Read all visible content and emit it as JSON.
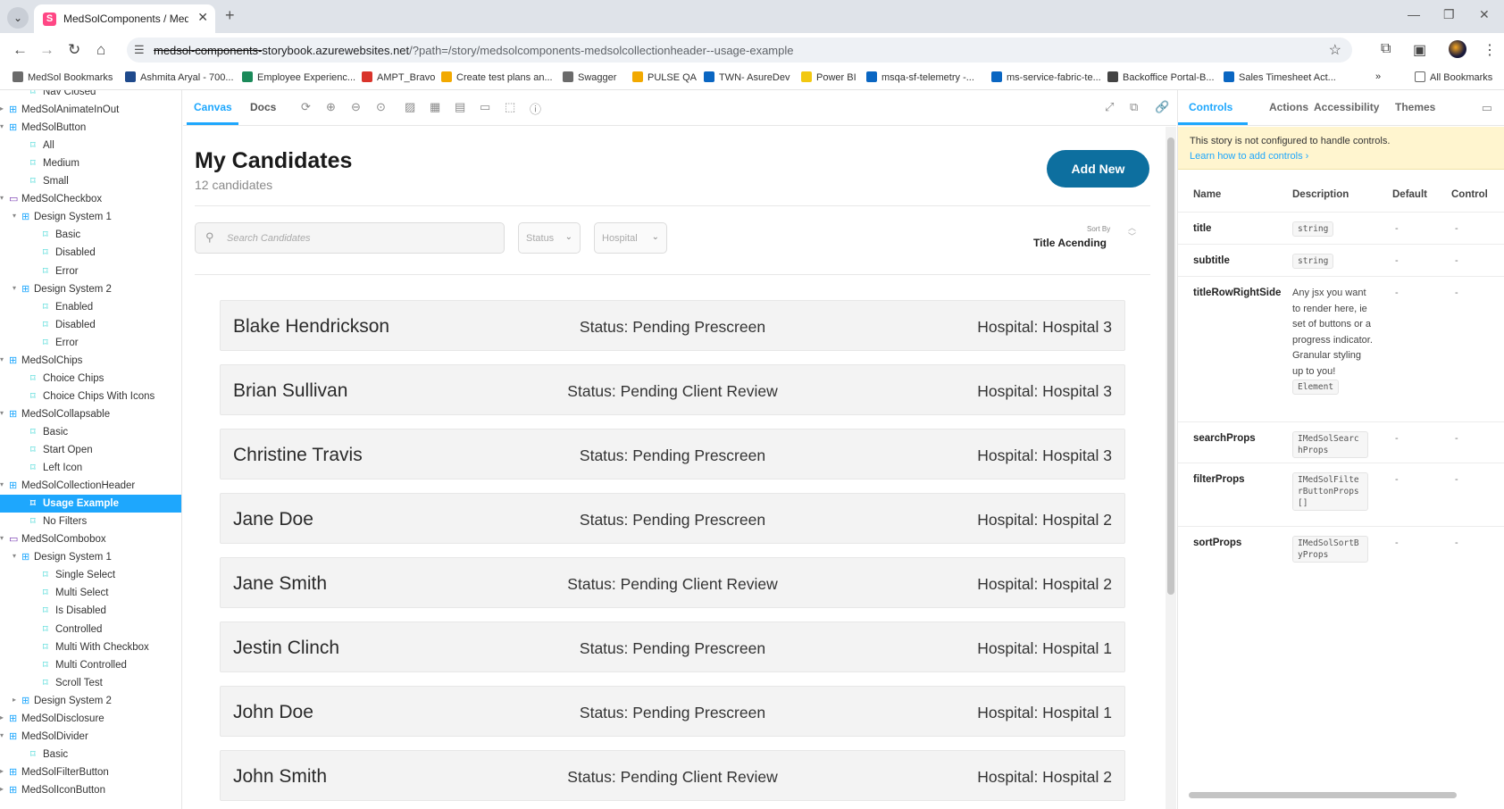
{
  "browser": {
    "tab_title": "MedSolComponents / MedSolC",
    "url_struck": "medsol-components-",
    "url_main": "storybook.azurewebsites.net",
    "url_rest": "/?path=/story/medsolcomponents-medsolcollectionheader--usage-example",
    "bookmarks": [
      {
        "label": "MedSol Bookmarks",
        "color": "#6b6b6b"
      },
      {
        "label": "Ashmita Aryal - 700...",
        "color": "#1f4a8c"
      },
      {
        "label": "Employee Experienc...",
        "color": "#1b8a5a"
      },
      {
        "label": "AMPT_Bravo",
        "color": "#d9342b"
      },
      {
        "label": "Create test plans an...",
        "color": "#f2a900"
      },
      {
        "label": "Swagger",
        "color": "#6b6b6b"
      },
      {
        "label": "PULSE QA",
        "color": "#f2a900"
      },
      {
        "label": "TWN- AsureDev",
        "color": "#0a66c2"
      },
      {
        "label": "Power BI",
        "color": "#f2c811"
      },
      {
        "label": "msqa-sf-telemetry -...",
        "color": "#0a66c2"
      },
      {
        "label": "ms-service-fabric-te...",
        "color": "#0a66c2"
      },
      {
        "label": "Backoffice Portal-B...",
        "color": "#444444"
      },
      {
        "label": "Sales Timesheet Act...",
        "color": "#0a66c2"
      }
    ],
    "all_bookmarks": "All Bookmarks"
  },
  "sidebar": {
    "items": [
      {
        "label": "Nav Closed",
        "level": 2,
        "kind": "story"
      },
      {
        "label": "MedSolAnimateInOut",
        "level": 0,
        "kind": "component"
      },
      {
        "label": "MedSolButton",
        "level": 0,
        "kind": "component",
        "open": true
      },
      {
        "label": "All",
        "level": 2,
        "kind": "story"
      },
      {
        "label": "Medium",
        "level": 2,
        "kind": "story"
      },
      {
        "label": "Small",
        "level": 2,
        "kind": "story"
      },
      {
        "label": "MedSolCheckbox",
        "level": 0,
        "kind": "folder",
        "open": true
      },
      {
        "label": "Design System 1",
        "level": 1,
        "kind": "component",
        "open": true
      },
      {
        "label": "Basic",
        "level": 3,
        "kind": "story"
      },
      {
        "label": "Disabled",
        "level": 3,
        "kind": "story"
      },
      {
        "label": "Error",
        "level": 3,
        "kind": "story"
      },
      {
        "label": "Design System 2",
        "level": 1,
        "kind": "component",
        "open": true
      },
      {
        "label": "Enabled",
        "level": 3,
        "kind": "story"
      },
      {
        "label": "Disabled",
        "level": 3,
        "kind": "story"
      },
      {
        "label": "Error",
        "level": 3,
        "kind": "story"
      },
      {
        "label": "MedSolChips",
        "level": 0,
        "kind": "component",
        "open": true
      },
      {
        "label": "Choice Chips",
        "level": 2,
        "kind": "story"
      },
      {
        "label": "Choice Chips With Icons",
        "level": 2,
        "kind": "story"
      },
      {
        "label": "MedSolCollapsable",
        "level": 0,
        "kind": "component",
        "open": true
      },
      {
        "label": "Basic",
        "level": 2,
        "kind": "story"
      },
      {
        "label": "Start Open",
        "level": 2,
        "kind": "story"
      },
      {
        "label": "Left Icon",
        "level": 2,
        "kind": "story"
      },
      {
        "label": "MedSolCollectionHeader",
        "level": 0,
        "kind": "component",
        "open": true
      },
      {
        "label": "Usage Example",
        "level": 2,
        "kind": "story",
        "selected": true
      },
      {
        "label": "No Filters",
        "level": 2,
        "kind": "story"
      },
      {
        "label": "MedSolCombobox",
        "level": 0,
        "kind": "folder",
        "open": true
      },
      {
        "label": "Design System 1",
        "level": 1,
        "kind": "component",
        "open": true
      },
      {
        "label": "Single Select",
        "level": 3,
        "kind": "story"
      },
      {
        "label": "Multi Select",
        "level": 3,
        "kind": "story"
      },
      {
        "label": "Is Disabled",
        "level": 3,
        "kind": "story"
      },
      {
        "label": "Controlled",
        "level": 3,
        "kind": "story"
      },
      {
        "label": "Multi With Checkbox",
        "level": 3,
        "kind": "story"
      },
      {
        "label": "Multi Controlled",
        "level": 3,
        "kind": "story"
      },
      {
        "label": "Scroll Test",
        "level": 3,
        "kind": "story"
      },
      {
        "label": "Design System 2",
        "level": 1,
        "kind": "component"
      },
      {
        "label": "MedSolDisclosure",
        "level": 0,
        "kind": "component"
      },
      {
        "label": "MedSolDivider",
        "level": 0,
        "kind": "component",
        "open": true
      },
      {
        "label": "Basic",
        "level": 2,
        "kind": "story"
      },
      {
        "label": "MedSolFilterButton",
        "level": 0,
        "kind": "component"
      },
      {
        "label": "MedSolIconButton",
        "level": 0,
        "kind": "component"
      }
    ]
  },
  "canvas": {
    "tabs": [
      "Canvas",
      "Docs"
    ],
    "title": "My Candidates",
    "subtitle": "12 candidates",
    "add_button": "Add New",
    "search_placeholder": "Search Candidates",
    "filters": [
      "Status",
      "Hospital"
    ],
    "sort_label": "Sort By",
    "sort_value": "Title Acending",
    "rows": [
      {
        "name": "Blake Hendrickson",
        "status": "Status: Pending Prescreen",
        "hospital": "Hospital: Hospital 3"
      },
      {
        "name": "Brian Sullivan",
        "status": "Status: Pending Client Review",
        "hospital": "Hospital: Hospital 3"
      },
      {
        "name": "Christine Travis",
        "status": "Status: Pending Prescreen",
        "hospital": "Hospital: Hospital 3"
      },
      {
        "name": "Jane Doe",
        "status": "Status: Pending Prescreen",
        "hospital": "Hospital: Hospital 2"
      },
      {
        "name": "Jane Smith",
        "status": "Status: Pending Client Review",
        "hospital": "Hospital: Hospital 2"
      },
      {
        "name": "Jestin Clinch",
        "status": "Status: Pending Prescreen",
        "hospital": "Hospital: Hospital 1"
      },
      {
        "name": "John Doe",
        "status": "Status: Pending Prescreen",
        "hospital": "Hospital: Hospital 1"
      },
      {
        "name": "John Smith",
        "status": "Status: Pending Client Review",
        "hospital": "Hospital: Hospital 2"
      }
    ]
  },
  "addons": {
    "tabs": [
      "Controls",
      "Actions",
      "Accessibility",
      "Themes"
    ],
    "notice_text": "This story is not configured to handle controls.",
    "notice_link": "Learn how to add controls ›",
    "headers": [
      "Name",
      "Description",
      "Default",
      "Control"
    ],
    "props": [
      {
        "name": "title",
        "desc": "",
        "code": "string",
        "default": "-",
        "control": "-"
      },
      {
        "name": "subtitle",
        "desc": "",
        "code": "string",
        "default": "-",
        "control": "-"
      },
      {
        "name": "titleRowRightSide",
        "desc": "Any jsx you want to render here, ie set of buttons or a progress indicator. Granular styling up to you!",
        "code": "Element",
        "default": "-",
        "control": "-"
      },
      {
        "name": "searchProps",
        "desc": "",
        "code": "IMedSolSearchProps",
        "default": "-",
        "control": "-"
      },
      {
        "name": "filterProps",
        "desc": "",
        "code": "IMedSolFilterButtonProps[]",
        "default": "-",
        "control": "-"
      },
      {
        "name": "sortProps",
        "desc": "",
        "code": "IMedSolSortByProps",
        "default": "-",
        "control": "-"
      }
    ]
  },
  "colors": {
    "accent": "#1ea7fd",
    "add_button": "#0d6f9f",
    "notice_bg": "#fff5cf"
  }
}
